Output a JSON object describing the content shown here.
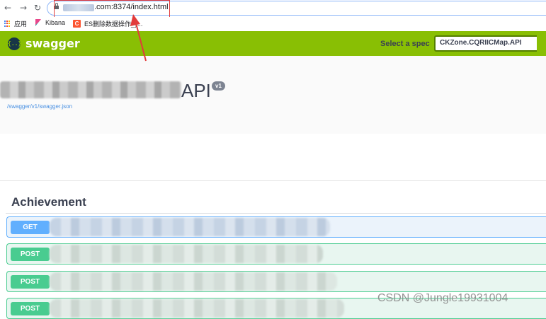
{
  "browser": {
    "back_icon": "arrow-left-icon",
    "forward_icon": "arrow-right-icon",
    "reload_icon": "reload-icon",
    "url_visible": ".com:8374/index.html",
    "bookmarks": [
      {
        "label": "应用",
        "icon": "apps-grid-icon"
      },
      {
        "label": "Kibana",
        "icon": "kibana-icon"
      },
      {
        "label": "ES删除数据操作_y...",
        "icon": "csdn-icon"
      }
    ]
  },
  "swagger": {
    "brand": "swagger",
    "logo_glyph": "{..}",
    "spec_label": "Select a spec",
    "spec_value": "CKZone.CQRIICMap.API",
    "api_title_suffix": "API",
    "version": "v1",
    "spec_link": "/swagger/v1/swagger.json",
    "tag": "Achievement",
    "operations": [
      {
        "method": "GET"
      },
      {
        "method": "POST"
      },
      {
        "method": "POST"
      },
      {
        "method": "POST"
      }
    ],
    "colors": {
      "topbar": "#89bf04",
      "get": "#61affe",
      "post": "#49cc90",
      "annotation": "#e23b3b"
    }
  },
  "watermark": "CSDN @Jungle19931004"
}
